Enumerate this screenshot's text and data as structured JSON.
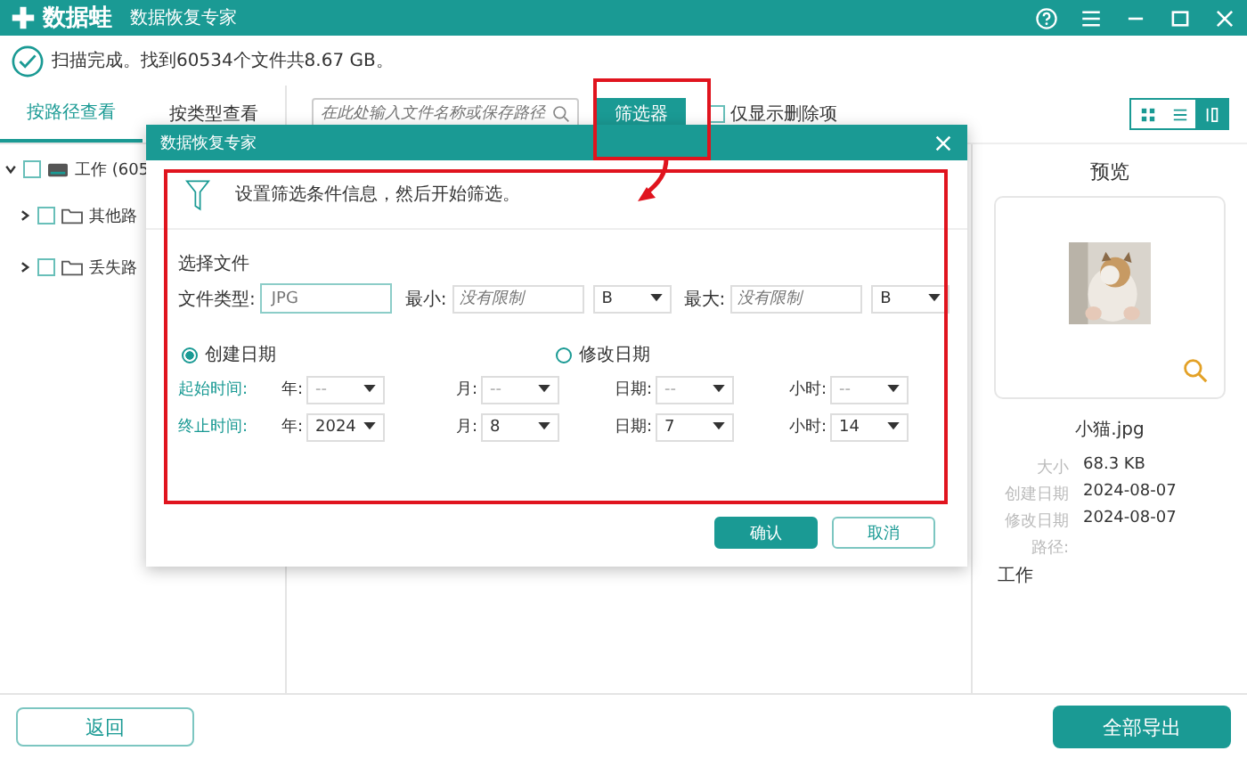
{
  "app": {
    "title": "数据蛙",
    "subtitle": "数据恢复专家"
  },
  "scan_status": "扫描完成。找到60534个文件共8.67 GB。",
  "view_tabs": [
    {
      "label": "按路径查看",
      "selected": true
    },
    {
      "label": "按类型查看",
      "selected": false
    }
  ],
  "search": {
    "placeholder": "在此处输入文件名称或保存路径"
  },
  "filter_button": "筛选器",
  "deleted_only": {
    "label": "仅显示删除项",
    "checked": false
  },
  "view_modes": [
    {
      "kind": "grid",
      "selected": false
    },
    {
      "kind": "list",
      "selected": false
    },
    {
      "kind": "detail",
      "selected": true
    }
  ],
  "tree": [
    {
      "label": "工作 (605",
      "checked": false,
      "expanded": true,
      "kind": "drive",
      "children": [
        {
          "label": "其他路",
          "checked": false,
          "expanded": false,
          "kind": "folder"
        },
        {
          "label": "丢失路",
          "checked": false,
          "expanded": false,
          "kind": "folder"
        }
      ]
    }
  ],
  "dialog": {
    "title": "数据恢复专家",
    "instruction": "设置筛选条件信息，然后开始筛选。",
    "section": "选择文件",
    "file_type": {
      "label": "文件类型:",
      "placeholder": "JPG"
    },
    "size_fields": [
      {
        "label": "最小:",
        "placeholder": "没有限制",
        "unit": "B"
      },
      {
        "label": "最大:",
        "placeholder": "没有限制",
        "unit": "B"
      }
    ],
    "date_modes": [
      {
        "label": "创建日期",
        "selected": true
      },
      {
        "label": "修改日期",
        "selected": false
      }
    ],
    "time_rows": [
      {
        "label": "起始时间:",
        "fields": [
          {
            "label": "年:",
            "value": "--"
          },
          {
            "label": "月:",
            "value": "--"
          },
          {
            "label": "日期:",
            "value": "--"
          },
          {
            "label": "小时:",
            "value": "--"
          }
        ]
      },
      {
        "label": "终止时间:",
        "fields": [
          {
            "label": "年:",
            "value": "2024"
          },
          {
            "label": "月:",
            "value": "8"
          },
          {
            "label": "日期:",
            "value": "7"
          },
          {
            "label": "小时:",
            "value": "14"
          }
        ]
      }
    ],
    "buttons": [
      {
        "label": "确认",
        "kind": "primary"
      },
      {
        "label": "取消",
        "kind": "secondary"
      }
    ]
  },
  "preview": {
    "title": "预览",
    "file_name": "小猫.jpg",
    "details": [
      {
        "label": "大小",
        "value": "68.3 KB"
      },
      {
        "label": "创建日期",
        "value": "2024-08-07"
      },
      {
        "label": "修改日期",
        "value": "2024-08-07"
      }
    ],
    "path_label": "路径:",
    "path": "工作"
  },
  "footer": {
    "back": "返回",
    "export": "全部导出"
  }
}
